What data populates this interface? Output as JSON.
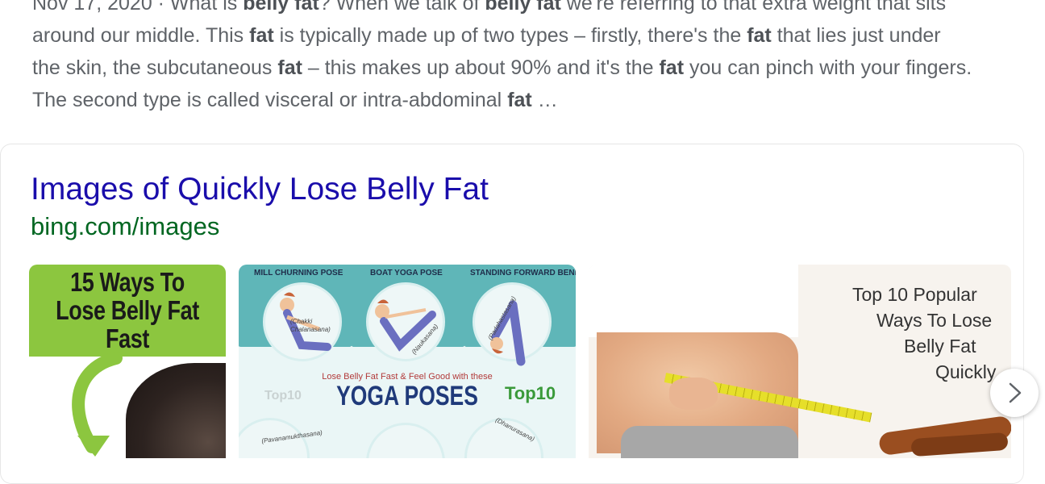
{
  "snippet": {
    "lines": [
      [
        {
          "t": "Nov 17, 2020 · What is ",
          "b": false
        },
        {
          "t": "belly fat",
          "b": true
        },
        {
          "t": "? When we talk of ",
          "b": false
        },
        {
          "t": "belly fat",
          "b": true
        },
        {
          "t": " we're referring to that extra weight that sits",
          "b": false
        }
      ],
      [
        {
          "t": "around our middle. This ",
          "b": false
        },
        {
          "t": "fat",
          "b": true
        },
        {
          "t": " is typically made up of two types – firstly, there's the ",
          "b": false
        },
        {
          "t": "fat",
          "b": true
        },
        {
          "t": " that lies just under",
          "b": false
        }
      ],
      [
        {
          "t": "the skin, the subcutaneous ",
          "b": false
        },
        {
          "t": "fat",
          "b": true
        },
        {
          "t": " – this makes up about 90% and it's the ",
          "b": false
        },
        {
          "t": "fat",
          "b": true
        },
        {
          "t": " you can pinch with your fingers.",
          "b": false
        }
      ],
      [
        {
          "t": "The second type is called visceral or intra-abdominal ",
          "b": false
        },
        {
          "t": "fat",
          "b": true
        },
        {
          "t": " …",
          "b": false
        }
      ]
    ]
  },
  "images_card": {
    "title": "Images of Quickly Lose Belly Fat",
    "url": "bing.com/images",
    "thumb1": {
      "title_lines": [
        "15 Ways To",
        "Lose Belly Fat",
        "Fast"
      ]
    },
    "thumb2": {
      "captions": [
        "MILL CHURNING POSE",
        "BOAT YOGA POSE",
        "STANDING FORWARD BEND"
      ],
      "latin_names": [
        "(Chakki Chalanasana)",
        "(Naukasana)",
        "(Padahastasana)",
        "(Pavanamukthasana)",
        "(Dhanurasana)"
      ],
      "subtitle": "Lose Belly Fat Fast & Feel Good with these",
      "headline": "YOGA POSES",
      "logo": "Top10",
      "logo_ghost": "Top10"
    },
    "thumb3": {
      "label_lines": [
        "Top 10 Popular",
        "Ways To Lose",
        "Belly Fat",
        "Quickly"
      ]
    },
    "next_icon": "chevron-right-icon"
  }
}
